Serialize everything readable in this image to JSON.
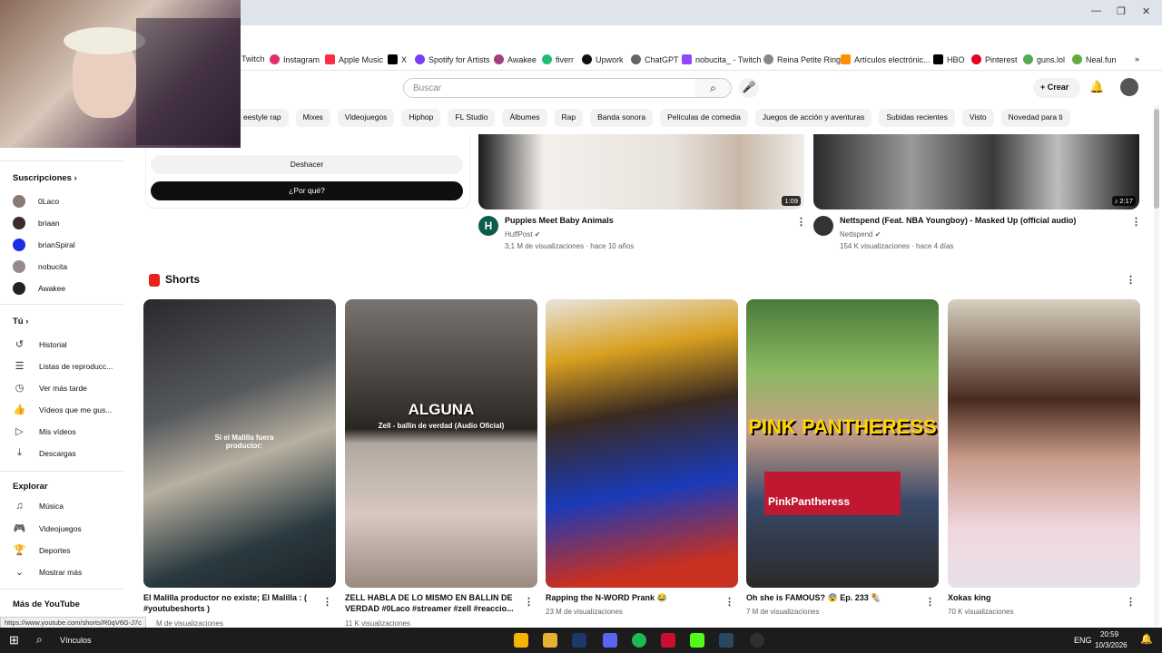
{
  "bookmarks": [
    "Twitch",
    "Instagram",
    "Apple Music",
    "X",
    "Spotify for Artists",
    "Awakee",
    "fiverr",
    "Upwork",
    "ChatGPT",
    "nobucita_ - Twitch",
    "Reina Petite Ring",
    "Artículos electrónic...",
    "HBO",
    "Pinterest",
    "guns.lol",
    "Neal.fun"
  ],
  "header": {
    "search_placeholder": "Buscar",
    "create_label": "Crear"
  },
  "chips": [
    "eestyle rap",
    "Mixes",
    "Videojuegos",
    "Hiphop",
    "FL Studio",
    "Álbumes",
    "Rap",
    "Banda sonora",
    "Películas de comedia",
    "Juegos de acción y aventuras",
    "Subidas recientes",
    "Visto",
    "Novedad para ti"
  ],
  "feedback": {
    "undo": "Deshacer",
    "why": "¿Por qué?"
  },
  "sidebar": {
    "subs_title": "Suscripciones",
    "subs": [
      {
        "name": "0Laco",
        "color": "#8a7a70"
      },
      {
        "name": "briaan",
        "color": "#3a2c2a"
      },
      {
        "name": "brianSpiral",
        "color": "#1a2ee8"
      },
      {
        "name": "nobucita",
        "color": "#9a8a90"
      },
      {
        "name": "Awakee",
        "color": "#222"
      }
    ],
    "you_title": "Tú",
    "you": [
      {
        "label": "Historial",
        "icon": "↺"
      },
      {
        "label": "Listas de reproducc...",
        "icon": "☰"
      },
      {
        "label": "Ver más tarde",
        "icon": "◷"
      },
      {
        "label": "Vídeos que me gus...",
        "icon": "👍"
      },
      {
        "label": "Mis vídeos",
        "icon": "▷"
      },
      {
        "label": "Descargas",
        "icon": "⤓"
      }
    ],
    "explore_title": "Explorar",
    "explore": [
      {
        "label": "Música",
        "icon": "♫"
      },
      {
        "label": "Videojuegos",
        "icon": "🎮"
      },
      {
        "label": "Deportes",
        "icon": "🏆"
      },
      {
        "label": "Mostrar más",
        "icon": "⌄"
      }
    ],
    "more_title": "Más de YouTube"
  },
  "videos": [
    {
      "title": "Puppies Meet Baby Animals",
      "channel": "HuffPost",
      "stats": "3,1 M de visualizaciones · hace 10 años",
      "duration": "1:09"
    },
    {
      "title": "Nettspend (Feat. NBA Youngboy) - Masked Up (official audio)",
      "channel": "Nettspend",
      "stats": "154 K visualizaciones · hace 4 días",
      "duration": "♪ 2:17"
    }
  ],
  "shorts_title": "Shorts",
  "shorts": [
    {
      "title": "El Malilla productor no existe; El Malilla : ( #youtubeshorts )",
      "views": "M de visualizaciones",
      "overlay": "Si el Malilla fuera productor:"
    },
    {
      "title": "ZELL HABLA DE LO MISMO EN BALLIN DE VERDAD #0Laco #streamer #zell #reaccio...",
      "views": "11 K visualizaciones",
      "overlay": "ALGUNA",
      "overlay2": "Zell - ballin de verdad (Audio Oficial)"
    },
    {
      "title": "Rapping the N-WORD Prank 😂",
      "views": "23 M de visualizaciones",
      "overlay": ""
    },
    {
      "title": "Oh she is FAMOUS? 😨 Ep. 233 🌯",
      "views": "7 M de visualizaciones",
      "overlay": "PINK PANTHERESS",
      "overlay2": "PinkPantheress"
    },
    {
      "title": "Xokas king",
      "views": "70 K visualizaciones",
      "overlay": ""
    }
  ],
  "status_url": "https://www.youtube.com/shorts/R0qV6G-J7c",
  "taskbar": {
    "search": "Vínculos",
    "lang": "ENG",
    "time": "20:59",
    "date": "10/3/2026"
  }
}
